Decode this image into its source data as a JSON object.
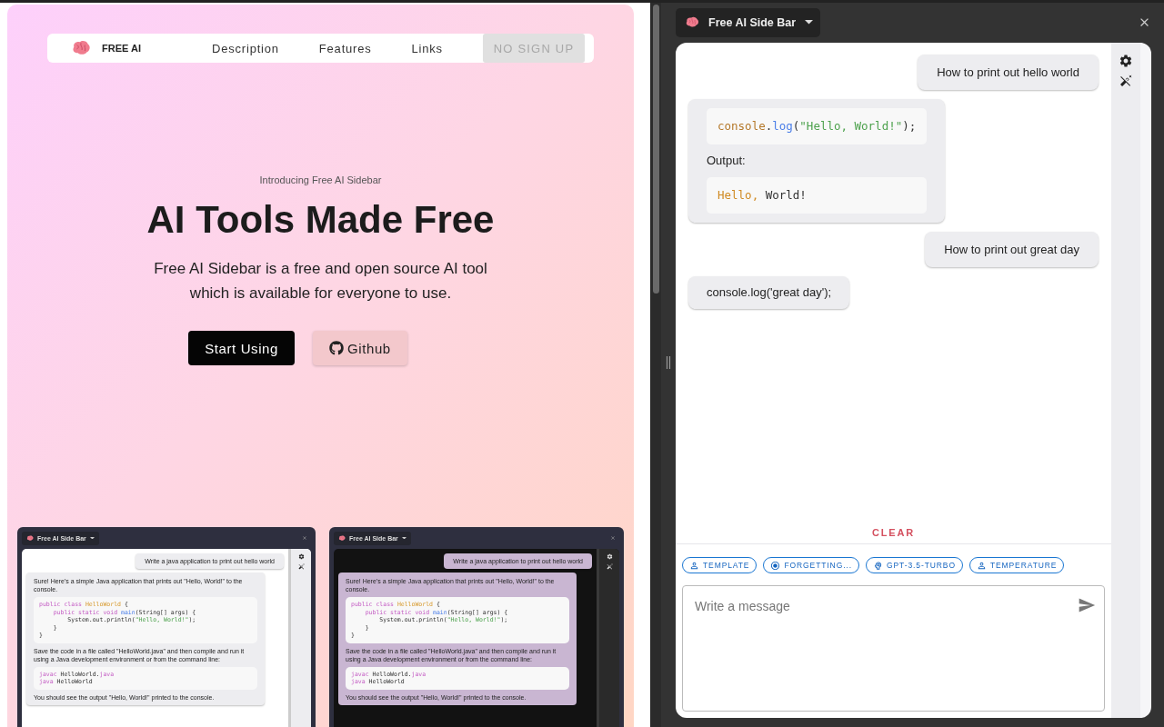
{
  "nav": {
    "brand": "FREE AI",
    "links": [
      "Description",
      "Features",
      "Links"
    ],
    "cta": {
      "label": "NO SIGN UP",
      "disabled": true
    }
  },
  "hero": {
    "eyebrow": "Introducing Free AI Sidebar",
    "title": "AI Tools Made Free",
    "subtitle": [
      "Free AI Sidebar is a free and open source AI tool",
      "which is available for everyone to use."
    ],
    "buttons": [
      {
        "label": "Start Using",
        "kind": "primary"
      },
      {
        "label": "Github",
        "kind": "github"
      }
    ]
  },
  "previews": [
    {
      "dark": false,
      "tab": "Free AI Side Bar",
      "messages": [
        {
          "kind": "user",
          "text": "Write a java application to print out hello world"
        },
        {
          "kind": "assistant",
          "blocks": [
            {
              "kind": "text",
              "text": "Sure! Here's a simple Java application that prints out \"Hello, World!\" to the console."
            },
            {
              "kind": "code",
              "lines": [
                [
                  {
                    "text": "public class ",
                    "kind": "keyword"
                  },
                  {
                    "text": "HelloWorld",
                    "kind": "type"
                  },
                  {
                    "text": " {",
                    "kind": "plain"
                  }
                ],
                [
                  {
                    "text": "    public static void ",
                    "kind": "keyword"
                  },
                  {
                    "text": "main",
                    "kind": "function"
                  },
                  {
                    "text": "(String[] args) {",
                    "kind": "plain"
                  }
                ],
                [
                  {
                    "text": "        System.out.println(",
                    "kind": "plain"
                  },
                  {
                    "text": "\"Hello, World!\"",
                    "kind": "string"
                  },
                  {
                    "text": ");",
                    "kind": "plain"
                  }
                ],
                [
                  {
                    "text": "    }",
                    "kind": "plain"
                  }
                ],
                [
                  {
                    "text": "}",
                    "kind": "plain"
                  }
                ]
              ]
            },
            {
              "kind": "text",
              "text": "Save the code in a file called \"HelloWorld.java\" and then compile and run it using a Java development environment or from the command line:"
            },
            {
              "kind": "code",
              "lines": [
                [
                  {
                    "text": "javac ",
                    "kind": "keyword"
                  },
                  {
                    "text": "HelloWorld.",
                    "kind": "plain"
                  },
                  {
                    "text": "java",
                    "kind": "keyword"
                  }
                ],
                [
                  {
                    "text": "java ",
                    "kind": "keyword"
                  },
                  {
                    "text": "HelloWorld",
                    "kind": "plain"
                  }
                ]
              ]
            },
            {
              "kind": "text",
              "text": "You should see the output \"Hello, World!\" printed to the console."
            }
          ]
        }
      ]
    },
    {
      "dark": true,
      "tab": "Free AI Side Bar",
      "messages": [
        {
          "kind": "user",
          "text": "Write a java application to print out hello world"
        },
        {
          "kind": "assistant",
          "blocks": [
            {
              "kind": "text",
              "text": "Sure! Here's a simple Java application that prints out \"Hello, World!\" to the console."
            },
            {
              "kind": "code",
              "lines": [
                [
                  {
                    "text": "public class ",
                    "kind": "keyword"
                  },
                  {
                    "text": "HelloWorld",
                    "kind": "type"
                  },
                  {
                    "text": " {",
                    "kind": "plain"
                  }
                ],
                [
                  {
                    "text": "    public static void ",
                    "kind": "keyword"
                  },
                  {
                    "text": "main",
                    "kind": "function"
                  },
                  {
                    "text": "(String[] args) {",
                    "kind": "plain"
                  }
                ],
                [
                  {
                    "text": "        System.out.println(",
                    "kind": "plain"
                  },
                  {
                    "text": "\"Hello, World!\"",
                    "kind": "string"
                  },
                  {
                    "text": ");",
                    "kind": "plain"
                  }
                ],
                [
                  {
                    "text": "    }",
                    "kind": "plain"
                  }
                ],
                [
                  {
                    "text": "}",
                    "kind": "plain"
                  }
                ]
              ]
            },
            {
              "kind": "text",
              "text": "Save the code in a file called \"HelloWorld.java\" and then compile and run it using a Java development environment or from the command line:"
            },
            {
              "kind": "code",
              "lines": [
                [
                  {
                    "text": "javac ",
                    "kind": "keyword"
                  },
                  {
                    "text": "HelloWorld.",
                    "kind": "plain"
                  },
                  {
                    "text": "java",
                    "kind": "keyword"
                  }
                ],
                [
                  {
                    "text": "java ",
                    "kind": "keyword"
                  },
                  {
                    "text": "HelloWorld",
                    "kind": "plain"
                  }
                ]
              ]
            },
            {
              "kind": "text",
              "text": "You should see the output \"Hello, World!\" printed to the console."
            }
          ]
        }
      ]
    }
  ],
  "sidebar": {
    "tab": "Free AI Side Bar",
    "messages": [
      {
        "kind": "user",
        "text": "How to print out hello world"
      },
      {
        "kind": "assistant",
        "blocks": [
          {
            "kind": "code",
            "lines": [
              [
                {
                  "text": "console",
                  "kind": "object"
                },
                {
                  "text": ".",
                  "kind": "plain"
                },
                {
                  "text": "log",
                  "kind": "function"
                },
                {
                  "text": "(",
                  "kind": "plain"
                },
                {
                  "text": "\"Hello, World!\"",
                  "kind": "string"
                },
                {
                  "text": ");",
                  "kind": "plain"
                }
              ]
            ]
          },
          {
            "kind": "text",
            "text": "Output:"
          },
          {
            "kind": "code",
            "lines": [
              [
                {
                  "text": "Hello,",
                  "kind": "literal"
                },
                {
                  "text": " World!",
                  "kind": "plain"
                }
              ]
            ]
          }
        ]
      },
      {
        "kind": "user",
        "text": "How to print out great day"
      },
      {
        "kind": "assistant",
        "blocks": [
          {
            "kind": "text",
            "text": "console.log('great day');"
          }
        ]
      }
    ],
    "clear": "CLEAR",
    "chips": [
      {
        "label": "TEMPLATE",
        "kind": "person"
      },
      {
        "label": "FORGETTING...",
        "kind": "radio"
      },
      {
        "label": "GPT-3.5-TURBO",
        "kind": "brain"
      },
      {
        "label": "TEMPERATURE",
        "kind": "person"
      }
    ],
    "input": {
      "placeholder": "Write a message"
    }
  }
}
